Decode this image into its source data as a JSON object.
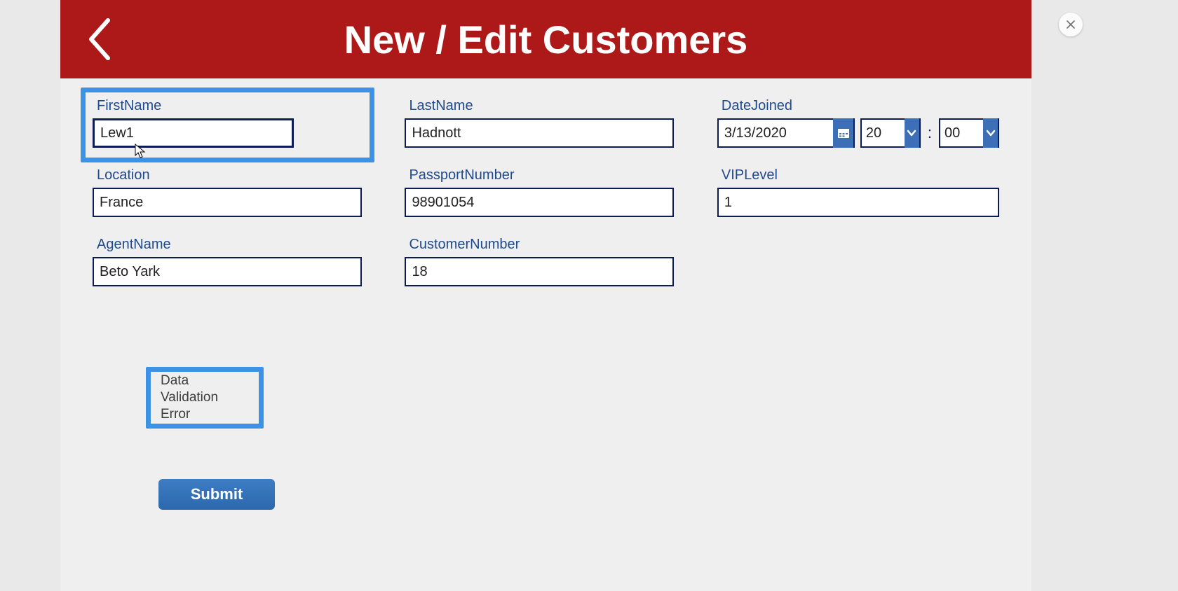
{
  "header": {
    "title": "New / Edit Customers"
  },
  "fields": {
    "firstName": {
      "label": "FirstName",
      "value": "Lew1"
    },
    "lastName": {
      "label": "LastName",
      "value": "Hadnott"
    },
    "dateJoined": {
      "label": "DateJoined",
      "value": "3/13/2020",
      "hour": "20",
      "minute": "00",
      "separator": ":"
    },
    "location": {
      "label": "Location",
      "value": "France"
    },
    "passportNumber": {
      "label": "PassportNumber",
      "value": "98901054"
    },
    "vipLevel": {
      "label": "VIPLevel",
      "value": "1"
    },
    "agentName": {
      "label": "AgentName",
      "value": "Beto Yark"
    },
    "customerNumber": {
      "label": "CustomerNumber",
      "value": "18"
    }
  },
  "validation": {
    "message": "Data Validation Error"
  },
  "actions": {
    "submit": "Submit"
  }
}
